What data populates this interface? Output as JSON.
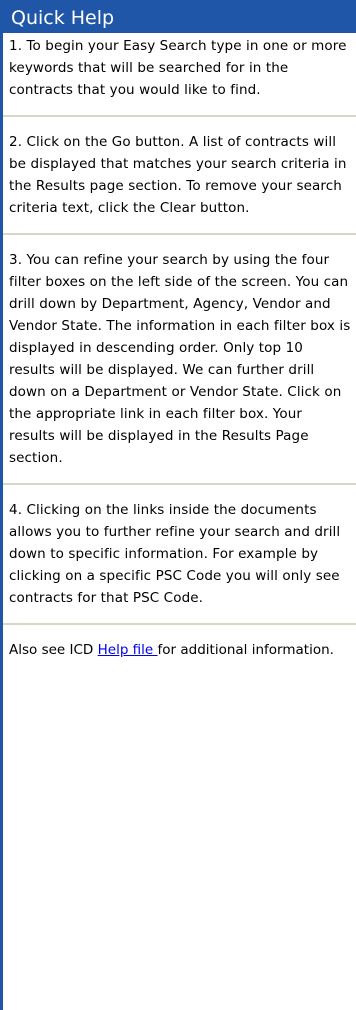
{
  "header": {
    "title": "Quick Help"
  },
  "sections": [
    {
      "text": "1. To begin your Easy Search type in one or more keywords that will be searched for in the contracts that you would like to find."
    },
    {
      "text": "2. Click on the Go button. A list of contracts will be displayed that matches your search criteria in the Results page section. To remove your search criteria text, click the Clear button."
    },
    {
      "text": "3. You can refine your search by using the four filter boxes on the left side of the screen. You can drill down by Department, Agency, Vendor and Vendor State. The information in each filter box is displayed in descending order. Only top 10 results will be displayed. We can further drill down on a Department or Vendor State. Click on the appropriate link in each filter box. Your results will be displayed in the Results Page section."
    },
    {
      "text": "4. Clicking on the links inside the documents allows you to further refine your search and drill down to specific information. For example by clicking on a specific PSC Code you will only see contracts for that PSC Code."
    }
  ],
  "footer": {
    "prefix": "Also see ICD ",
    "link_label": "Help file ",
    "suffix": "for additional information."
  },
  "colors": {
    "header_bg": "#1f56a8",
    "header_text": "#ffffff",
    "divider": "#d9d6c8",
    "link": "#0000ee"
  }
}
